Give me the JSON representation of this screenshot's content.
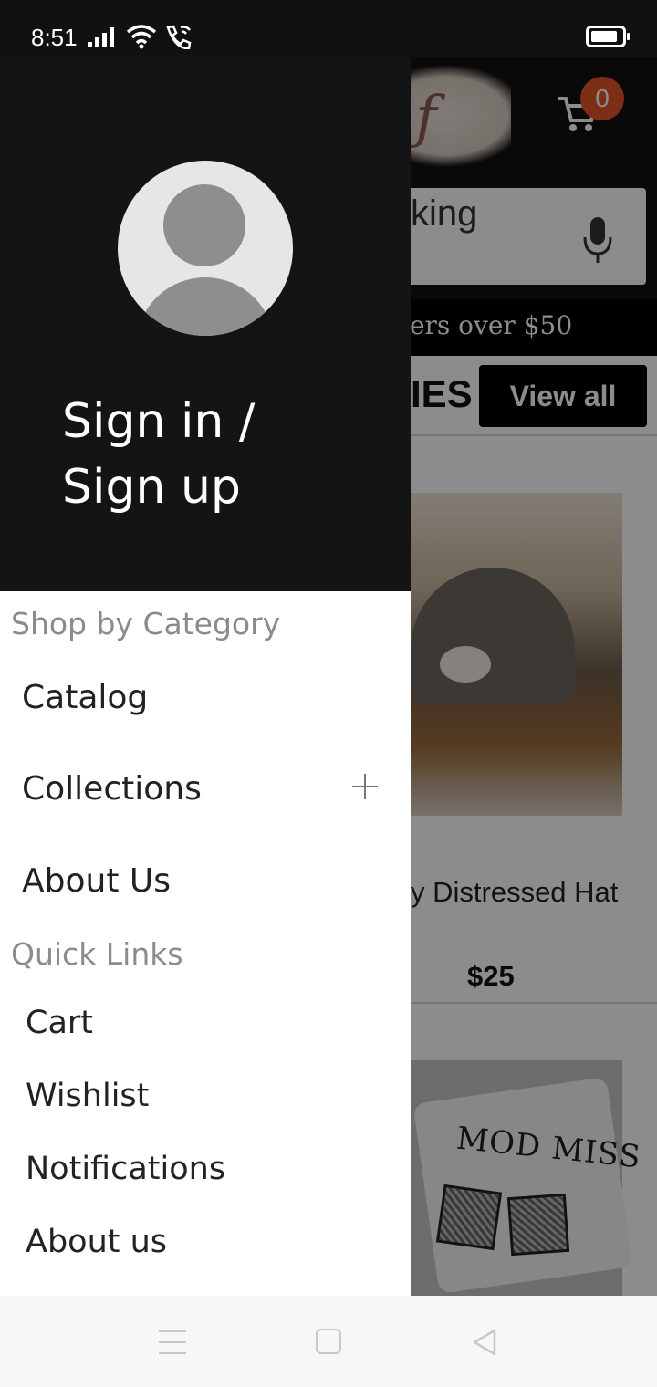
{
  "status_bar": {
    "time": "8:51"
  },
  "background": {
    "cart_count": "0",
    "search_text": "king",
    "promo_text": "lers over $50",
    "section_title": "IES",
    "view_all": "View all",
    "product_name": "y Distressed Hat",
    "product_price": "$25",
    "product_image_text": "MOD MISS",
    "brand_color": "#e2542a"
  },
  "drawer": {
    "sign_in": "Sign in / Sign up",
    "shop_label": "Shop by Category",
    "categories": [
      {
        "label": "Catalog"
      },
      {
        "label": "Collections"
      },
      {
        "label": "About Us"
      }
    ],
    "quick_label": "Quick Links",
    "quick_links": [
      {
        "label": "Cart"
      },
      {
        "label": "Wishlist"
      },
      {
        "label": "Notifications"
      },
      {
        "label": "About us"
      }
    ]
  },
  "icons": {
    "avatar": "user-avatar-icon",
    "expand": "plus-icon",
    "cart": "cart-icon",
    "mic": "microphone-icon"
  }
}
